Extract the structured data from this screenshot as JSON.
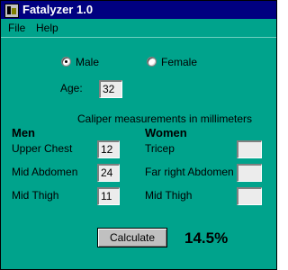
{
  "window": {
    "title": "Fatalyzer 1.0",
    "app_icon": "fatalyzer-app-icon"
  },
  "menu": {
    "items": [
      "File",
      "Help"
    ]
  },
  "gender": {
    "options": [
      {
        "label": "Male",
        "selected": true
      },
      {
        "label": "Female",
        "selected": false
      }
    ]
  },
  "age": {
    "label": "Age:",
    "value": "32"
  },
  "caliper_heading": "Caliper measurements in millimeters",
  "men": {
    "heading": "Men",
    "fields": [
      {
        "label": "Upper Chest",
        "value": "12"
      },
      {
        "label": "Mid Abdomen",
        "value": "24"
      },
      {
        "label": "Mid Thigh",
        "value": "11"
      }
    ]
  },
  "women": {
    "heading": "Women",
    "fields": [
      {
        "label": "Tricep",
        "value": ""
      },
      {
        "label": "Far right Abdomen",
        "value": ""
      },
      {
        "label": "Mid Thigh",
        "value": ""
      }
    ]
  },
  "calculate_button": {
    "label": "Calculate"
  },
  "result": "14.5%",
  "colors": {
    "window_bg": "#00a38c",
    "titlebar": "#000080",
    "field_bg": "#ececec"
  }
}
